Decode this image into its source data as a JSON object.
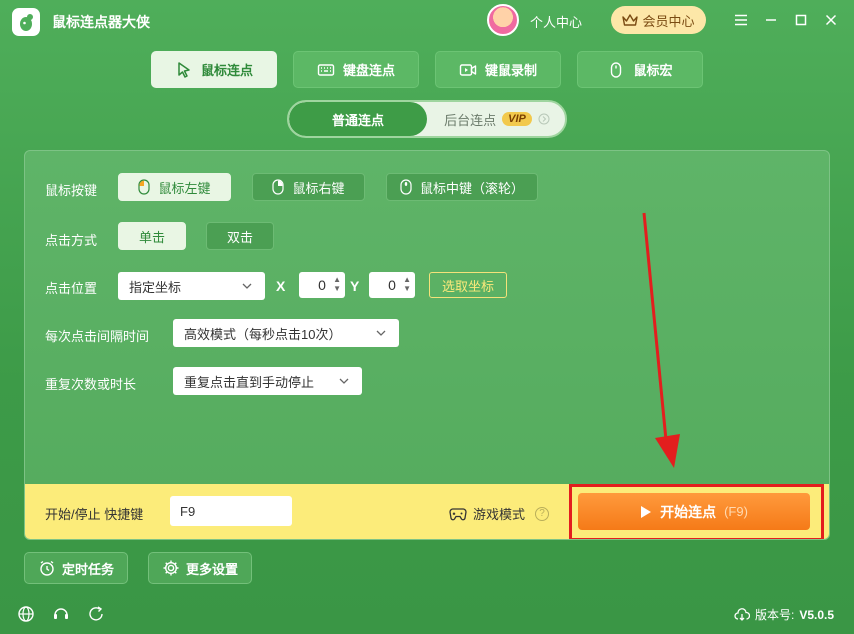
{
  "app": {
    "title": "鼠标连点器大侠"
  },
  "header": {
    "user_center": "个人中心",
    "vip_center": "会员中心"
  },
  "main_tabs": [
    {
      "label": "鼠标连点",
      "icon": "cursor-icon"
    },
    {
      "label": "键盘连点",
      "icon": "keyboard-icon"
    },
    {
      "label": "键鼠录制",
      "icon": "record-icon"
    },
    {
      "label": "鼠标宏",
      "icon": "mouse-icon"
    }
  ],
  "sub_tabs": [
    {
      "label": "普通连点"
    },
    {
      "label": "后台连点",
      "badge": "VIP"
    }
  ],
  "settings": {
    "mouse_button": {
      "label": "鼠标按键",
      "options": [
        "鼠标左键",
        "鼠标右键",
        "鼠标中键（滚轮）"
      ],
      "selected": "鼠标左键"
    },
    "click_mode": {
      "label": "点击方式",
      "options": [
        "单击",
        "双击"
      ],
      "selected": "单击"
    },
    "click_position": {
      "label": "点击位置",
      "select_value": "指定坐标",
      "x_label": "X",
      "x_value": "0",
      "y_label": "Y",
      "y_value": "0",
      "pick_label": "选取坐标"
    },
    "interval": {
      "label": "每次点击间隔时间",
      "value": "高效模式（每秒点击10次）"
    },
    "repeat": {
      "label": "重复次数或时长",
      "value": "重复点击直到手动停止"
    }
  },
  "bottom_bar": {
    "hotkey_label": "开始/停止 快捷键",
    "hotkey_value": "F9",
    "game_mode": "游戏模式",
    "help": "?",
    "start_label": "开始连点",
    "start_hotkey": "(F9)"
  },
  "footer": {
    "timer_task": "定时任务",
    "more_settings": "更多设置",
    "version_label": "版本号:",
    "version_value": "V5.0.5"
  },
  "colors": {
    "background": "#45a44f",
    "accent_yellow": "#fcec7a",
    "start_orange": "#f57a18",
    "annotation_red": "#e31e1e"
  }
}
